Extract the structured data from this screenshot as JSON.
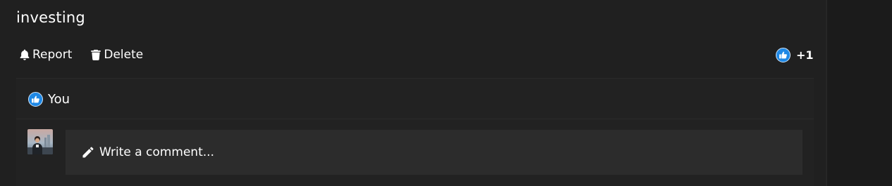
{
  "post": {
    "text": "investing"
  },
  "actions": {
    "report_label": "Report",
    "delete_label": "Delete"
  },
  "likes": {
    "count_label": "+1",
    "likers": [
      "You"
    ]
  },
  "comment": {
    "placeholder": "Write a comment..."
  },
  "icons": {
    "report": "bell-icon",
    "delete": "trash-icon",
    "like": "thumbs-up-icon",
    "comment": "pencil-icon"
  },
  "colors": {
    "like_accent": "#1e88e5",
    "background": "#202020",
    "comment_box": "#2c2c2c"
  }
}
